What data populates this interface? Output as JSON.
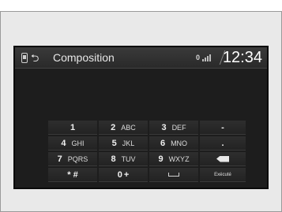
{
  "header": {
    "title": "Composition",
    "clock": "12:34",
    "status_text": "0"
  },
  "keypad": {
    "rows": [
      [
        {
          "digit": "1",
          "letters": ""
        },
        {
          "digit": "2",
          "letters": "ABC"
        },
        {
          "digit": "3",
          "letters": "DEF"
        },
        {
          "symbol": "-"
        }
      ],
      [
        {
          "digit": "4",
          "letters": "GHI"
        },
        {
          "digit": "5",
          "letters": "JKL"
        },
        {
          "digit": "6",
          "letters": "MNO"
        },
        {
          "symbol": "."
        }
      ],
      [
        {
          "digit": "7",
          "letters": "PQRS"
        },
        {
          "digit": "8",
          "letters": "TUV"
        },
        {
          "digit": "9",
          "letters": "WXYZ"
        },
        {
          "icon": "backspace-icon"
        }
      ],
      [
        {
          "symbol": "* #"
        },
        {
          "digit": "0",
          "letters": "+"
        },
        {
          "icon": "space-icon"
        },
        {
          "label": "Exécuté"
        }
      ]
    ]
  },
  "colors": {
    "screen_bg": "#1d1d1d",
    "key_text": "#f0f0f0",
    "frame_bg": "#e9e9e9"
  }
}
